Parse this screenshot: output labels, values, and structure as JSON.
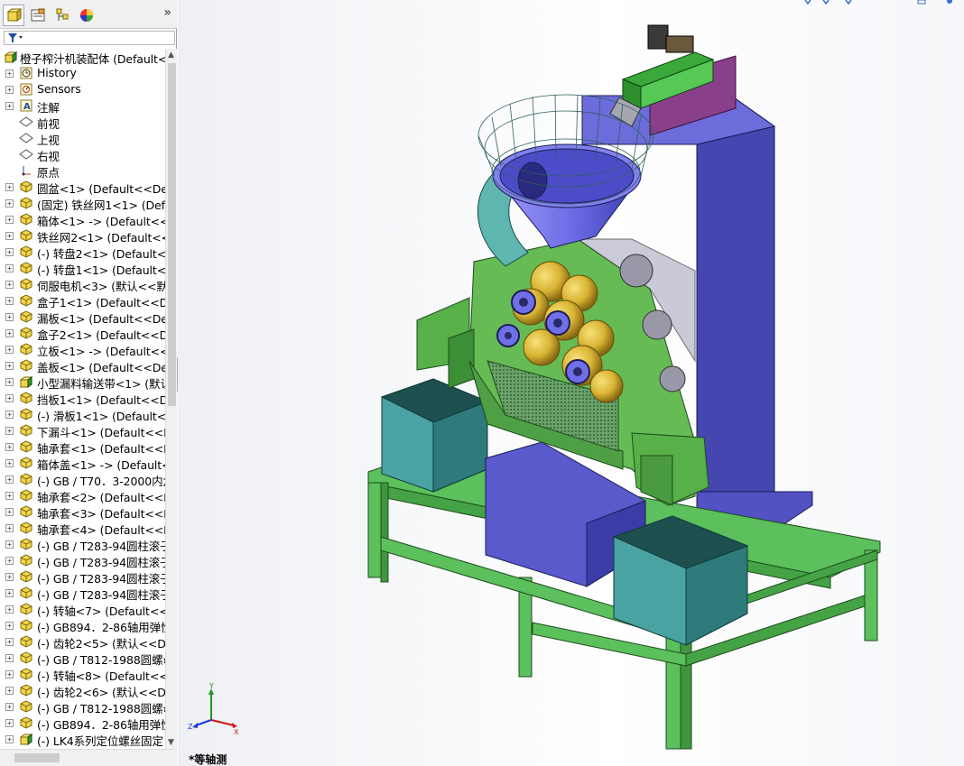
{
  "feature_tree": {
    "filter_icon": "filter-icon",
    "tab_expand_glyph": "»",
    "root": {
      "label": "橙子榨汁机装配体 (Default<<",
      "icon": "assembly-icon"
    },
    "items": [
      {
        "label": "History",
        "icon": "history-icon"
      },
      {
        "label": "Sensors",
        "icon": "sensors-icon"
      },
      {
        "label": "注解",
        "icon": "annotation-icon"
      },
      {
        "label": "前视",
        "icon": "plane-icon"
      },
      {
        "label": "上视",
        "icon": "plane-icon"
      },
      {
        "label": "右视",
        "icon": "plane-icon"
      },
      {
        "label": "原点",
        "icon": "origin-icon"
      },
      {
        "label": "圆盆<1> (Default<<Defa",
        "icon": "part-icon"
      },
      {
        "label": "(固定) 铁丝网1<1> (Defa",
        "icon": "part-icon"
      },
      {
        "label": "箱体<1> -> (Default<<D",
        "icon": "part-icon"
      },
      {
        "label": "铁丝网2<1> (Default<<D",
        "icon": "part-icon"
      },
      {
        "label": "(-) 转盘2<1> (Default<<",
        "icon": "part-icon"
      },
      {
        "label": "(-) 转盘1<1> (Default<<",
        "icon": "part-icon"
      },
      {
        "label": "伺服电机<3> (默认<<默认",
        "icon": "part-icon"
      },
      {
        "label": "盒子1<1> (Default<<De",
        "icon": "part-icon"
      },
      {
        "label": "漏板<1> (Default<<Defa",
        "icon": "part-icon"
      },
      {
        "label": "盒子2<1> (Default<<De",
        "icon": "part-icon"
      },
      {
        "label": "立板<1> -> (Default<<D",
        "icon": "part-icon"
      },
      {
        "label": "盖板<1> (Default<<Defa",
        "icon": "part-icon"
      },
      {
        "label": "小型漏料输送带<1> (默认",
        "icon": "subassembly-icon"
      },
      {
        "label": "挡板1<1> (Default<<De",
        "icon": "part-icon"
      },
      {
        "label": "(-) 滑板1<1> (Default<<",
        "icon": "part-icon"
      },
      {
        "label": "下漏斗<1> (Default<<De",
        "icon": "part-icon"
      },
      {
        "label": "轴承套<1> (Default<<De",
        "icon": "part-icon"
      },
      {
        "label": "箱体盖<1> -> (Default<",
        "icon": "part-icon"
      },
      {
        "label": "(-) GB / T70．3-2000内六",
        "icon": "part-icon"
      },
      {
        "label": "轴承套<2> (Default<<De",
        "icon": "part-icon"
      },
      {
        "label": "轴承套<3> (Default<<De",
        "icon": "part-icon"
      },
      {
        "label": "轴承套<4> (Default<<De",
        "icon": "part-icon"
      },
      {
        "label": "(-) GB / T283-94圆柱滚子",
        "icon": "part-icon"
      },
      {
        "label": "(-) GB / T283-94圆柱滚子",
        "icon": "part-icon"
      },
      {
        "label": "(-) GB / T283-94圆柱滚子",
        "icon": "part-icon"
      },
      {
        "label": "(-) GB / T283-94圆柱滚子",
        "icon": "part-icon"
      },
      {
        "label": "(-) 转轴<7> (Default<<D",
        "icon": "part-icon"
      },
      {
        "label": "(-) GB894．2-86轴用弹性",
        "icon": "part-icon"
      },
      {
        "label": "(-) 齿轮2<5> (默认<<De",
        "icon": "part-icon"
      },
      {
        "label": "(-) GB / T812-1988圆螺母",
        "icon": "part-icon"
      },
      {
        "label": "(-) 转轴<8> (Default<<D",
        "icon": "part-icon"
      },
      {
        "label": "(-) 齿轮2<6> (默认<<De",
        "icon": "part-icon"
      },
      {
        "label": "(-) GB / T812-1988圆螺母",
        "icon": "part-icon"
      },
      {
        "label": "(-) GB894．2-86轴用弹性",
        "icon": "part-icon"
      },
      {
        "label": "(-) LK4系列定位螺丝固定",
        "icon": "subassembly-icon"
      }
    ]
  },
  "viewport": {
    "view_name": "*等轴测",
    "triad_axes": {
      "x": "X",
      "y": "Y",
      "z": "Z"
    }
  },
  "colors": {
    "frame_green": "#5cc05c",
    "hopper_blue": "#6f6fe8",
    "housing_green": "#66bb55",
    "bin_teal": "#4aa3a3",
    "tower_purple": "#5a5acc",
    "fruit_yellow": "#d9b434"
  }
}
